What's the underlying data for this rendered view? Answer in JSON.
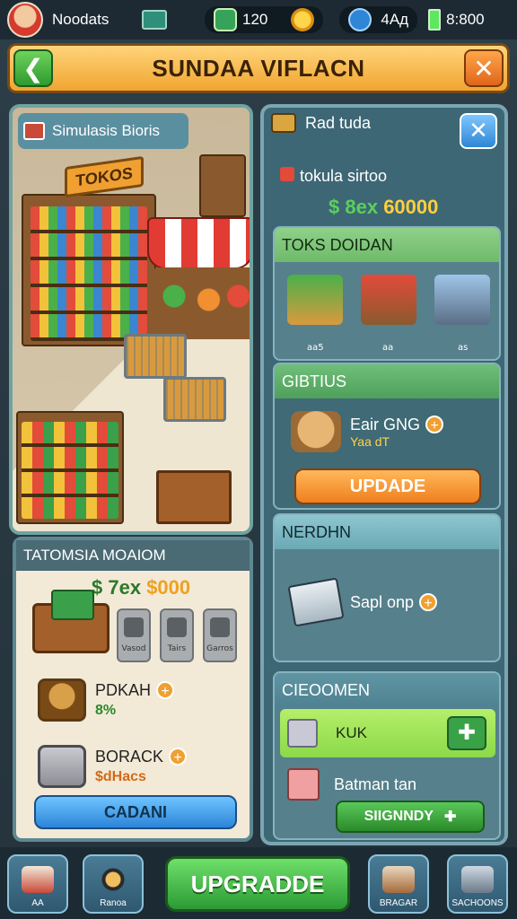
{
  "topbar": {
    "player_name": "Noodats",
    "cash": "120",
    "gems": "4Aд",
    "energy": "8:800"
  },
  "title": "SUNDAA VIFLACN",
  "left_panel": {
    "tag": "Simulasis Bioris",
    "store_sign": "TOKOS"
  },
  "left_bottom": {
    "header": "TATOMSIA MOAIOM",
    "price_prefix": "$ 7ex",
    "price_value": "$000",
    "slot_labels": [
      "Vasod",
      "Tairs",
      "Garros"
    ],
    "item1_name": "PDKAH",
    "item1_sub": "8%",
    "item2_name": "BORACK",
    "item2_sub": "$dHacs",
    "button": "CADANI"
  },
  "right_panel": {
    "header": "Rad tuda",
    "sub": "tokula sirtoo",
    "price_prefix": "$ 8ex",
    "price_value": "60000",
    "sec1_title": "TOKS DOIDAN",
    "sec1_labels": [
      "aa5",
      "aa",
      "as"
    ],
    "sec2_title": "GIBTIUS",
    "sec2_item": "Eair GNG",
    "sec2_sub": "Yaa dT",
    "sec2_button": "UPDADE",
    "sec3_title": "NERDHN",
    "sec3_item": "Sapl onp",
    "sec4_title": "CIEOOMEN",
    "sec4_item1": "KUK",
    "sec4_item2": "Batman tan",
    "sec4_button": "SIIGNNDY"
  },
  "bottomnav": {
    "items": [
      "AA",
      "Ranoa",
      "",
      "BRAGAR",
      "SACHOONS"
    ],
    "upgrade": "UPGRADDE"
  }
}
